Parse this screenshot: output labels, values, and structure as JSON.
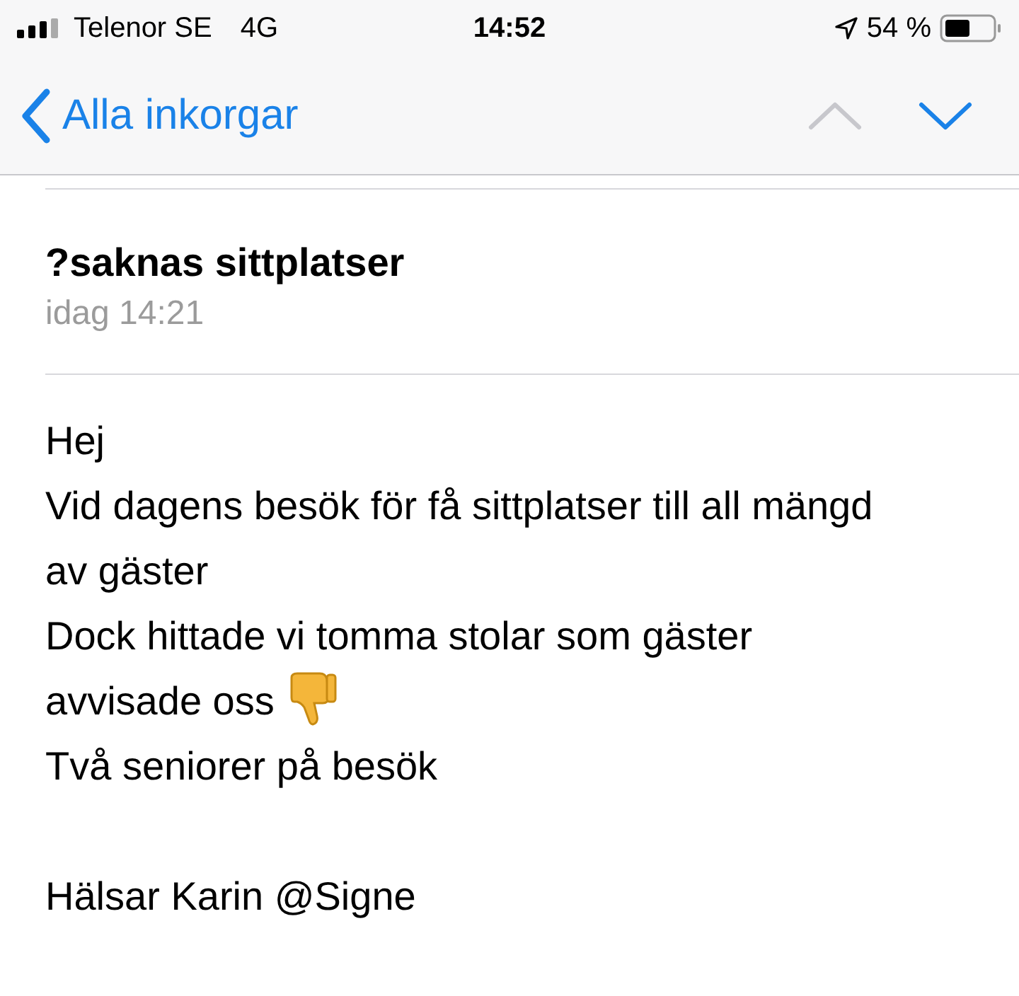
{
  "status_bar": {
    "carrier": "Telenor SE",
    "network": "4G",
    "time": "14:52",
    "battery": "54 %"
  },
  "nav_bar": {
    "back_label": "Alla inkorgar",
    "previous_disabled": true,
    "next_disabled": false
  },
  "message": {
    "subject": "?saknas sittplatser",
    "date": "idag 14:21",
    "body": [
      [
        "Hej",
        {
          "text": "Vid dagens besök för få sittplatser till all mängd av gäster",
          "trailing_icon": false
        },
        {
          "text": "Dock hittade vi tomma stolar som gäster avvisade oss",
          "trailing_icon": true
        },
        "Två seniorer på besök"
      ],
      [
        "Hälsar Karin @Signe"
      ]
    ]
  }
}
